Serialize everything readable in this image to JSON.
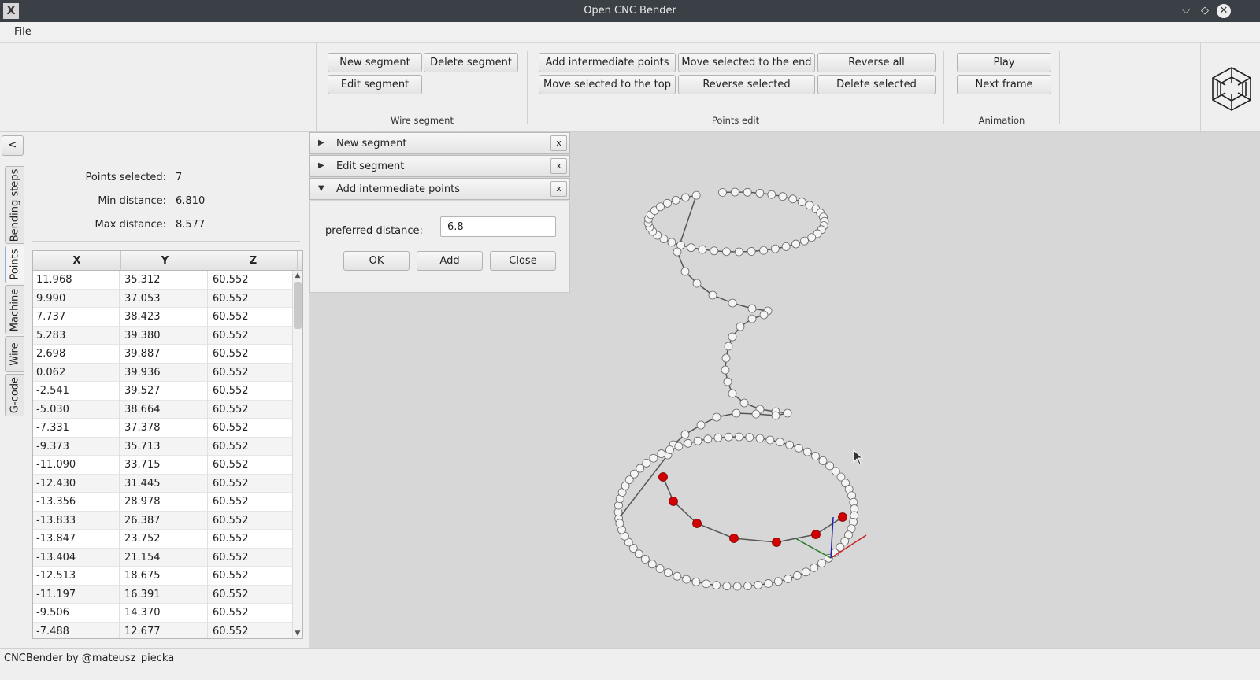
{
  "window": {
    "title": "Open CNC Bender",
    "icon_glyph": "X"
  },
  "menu": {
    "file_label": "File"
  },
  "toolbar": {
    "wire_segment": {
      "new_segment": "New segment",
      "delete_segment": "Delete segment",
      "edit_segment": "Edit segment",
      "group_label": "Wire segment"
    },
    "points_edit": {
      "add_intermediate_points": "Add intermediate points",
      "move_selected_to_end": "Move selected to the end",
      "reverse_all": "Reverse all",
      "move_selected_to_top": "Move selected to the top",
      "reverse_selected": "Reverse selected",
      "delete_selected": "Delete selected",
      "group_label": "Points edit"
    },
    "animation": {
      "play": "Play",
      "next_frame": "Next frame",
      "group_label": "Animation"
    }
  },
  "side_tabs": {
    "collapse_label": "<",
    "items": [
      "Bending steps",
      "Points",
      "Machine",
      "Wire",
      "G-code"
    ],
    "active": "Points"
  },
  "points_info": {
    "selected_label": "Points selected:",
    "selected_value": "7",
    "min_label": "Min distance:",
    "min_value": "6.810",
    "max_label": "Max distance:",
    "max_value": "8.577"
  },
  "points_table": {
    "columns": [
      "X",
      "Y",
      "Z"
    ],
    "rows": [
      [
        "11.968",
        "35.312",
        "60.552"
      ],
      [
        "9.990",
        "37.053",
        "60.552"
      ],
      [
        "7.737",
        "38.423",
        "60.552"
      ],
      [
        "5.283",
        "39.380",
        "60.552"
      ],
      [
        "2.698",
        "39.887",
        "60.552"
      ],
      [
        "0.062",
        "39.936",
        "60.552"
      ],
      [
        "-2.541",
        "39.527",
        "60.552"
      ],
      [
        "-5.030",
        "38.664",
        "60.552"
      ],
      [
        "-7.331",
        "37.378",
        "60.552"
      ],
      [
        "-9.373",
        "35.713",
        "60.552"
      ],
      [
        "-11.090",
        "33.715",
        "60.552"
      ],
      [
        "-12.430",
        "31.445",
        "60.552"
      ],
      [
        "-13.356",
        "28.978",
        "60.552"
      ],
      [
        "-13.833",
        "26.387",
        "60.552"
      ],
      [
        "-13.847",
        "23.752",
        "60.552"
      ],
      [
        "-13.404",
        "21.154",
        "60.552"
      ],
      [
        "-12.513",
        "18.675",
        "60.552"
      ],
      [
        "-11.197",
        "16.391",
        "60.552"
      ],
      [
        "-9.506",
        "14.370",
        "60.552"
      ],
      [
        "-7.488",
        "12.677",
        "60.552"
      ]
    ]
  },
  "accordion": {
    "panels": [
      {
        "label": "New segment",
        "expanded": false
      },
      {
        "label": "Edit segment",
        "expanded": false
      },
      {
        "label": "Add intermediate points",
        "expanded": true
      }
    ],
    "close_glyph": "x",
    "preferred_distance_label": "preferred distance:",
    "preferred_distance_value": "6.8",
    "ok_label": "OK",
    "add_label": "Add",
    "close_label": "Close"
  },
  "viewport": {
    "point_color": "#f4f4f4",
    "selected_point_color": "#d40000",
    "axis_x_color": "#cc2222",
    "axis_y_color": "#2a7a2a",
    "axis_z_color": "#2222aa"
  },
  "status": {
    "text": "CNCBender by @mateusz_piecka"
  }
}
